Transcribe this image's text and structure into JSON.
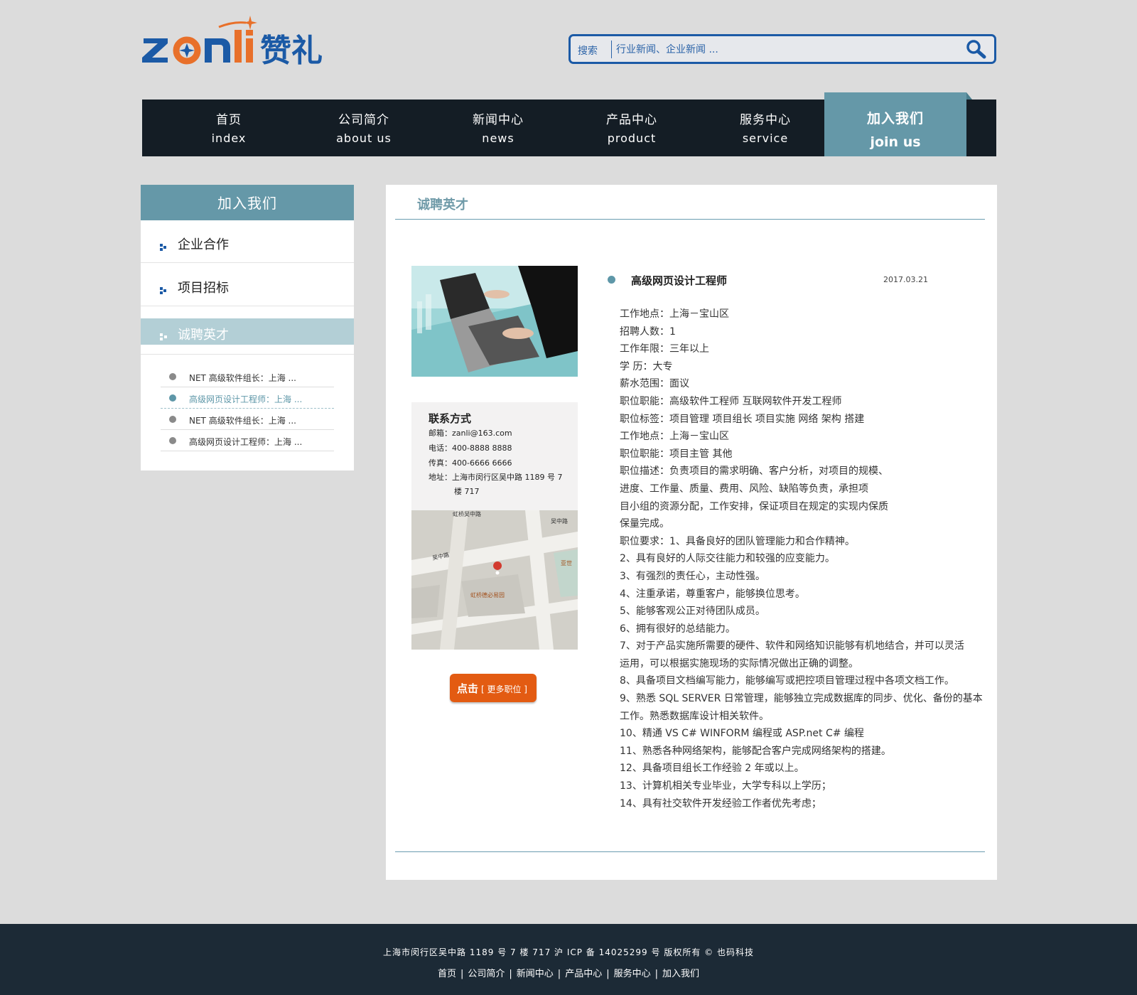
{
  "brand": {
    "logo_text_latin": "zonli",
    "logo_text_cn": "赞礼",
    "colors": {
      "blue": "#1b5aa6",
      "orange": "#e8702a",
      "teal": "#6598a8",
      "nav_bg": "#141d25",
      "footer_bg": "#1c2a36"
    }
  },
  "search": {
    "label": "搜索",
    "placeholder": "行业新闻、企业新闻 ..."
  },
  "nav": {
    "items": [
      {
        "cn": "首页",
        "en": "index"
      },
      {
        "cn": "公司简介",
        "en": "about us"
      },
      {
        "cn": "新闻中心",
        "en": "news"
      },
      {
        "cn": "产品中心",
        "en": "product"
      },
      {
        "cn": "服务中心",
        "en": "service"
      }
    ],
    "active": {
      "cn": "加入我们",
      "en": "join us"
    }
  },
  "sidebar": {
    "title": "加入我们",
    "links": [
      {
        "label": "企业合作"
      },
      {
        "label": "项目招标"
      }
    ],
    "active_link": "诚聘英才",
    "jobs": [
      {
        "title": "NET 高级软件组长：上海 ..."
      },
      {
        "title": "高级网页设计工程师：上海 ..."
      },
      {
        "title": "NET 高级软件组长：上海 ..."
      },
      {
        "title": "高级网页设计工程师：上海 ..."
      }
    ]
  },
  "main": {
    "title": "诚聘英才",
    "contact": {
      "title": "联系方式",
      "email": "邮箱：zanli@163.com",
      "phone": "电话：400-8888 8888",
      "fax": "传真：400-6666 6666",
      "address_line1": "地址：上海市闵行区吴中路 1189 号 7",
      "address_line2": "楼 717"
    },
    "map_labels": {
      "road_top": "虹桥吴中路",
      "road_wuzhong": "吴中路",
      "road_right": "吴中路",
      "place": "虹桥德必易园",
      "right_label": "亚世"
    },
    "more_button": {
      "main": "点击",
      "sub": "[ 更多职位 ]"
    },
    "job": {
      "title": "高级网页设计工程师",
      "date": "2017.03.21",
      "lines": [
        "工作地点：上海－宝山区",
        "招聘人数：1",
        "工作年限：三年以上",
        "学  历：大专",
        "薪水范围：面议",
        "职位职能：高级软件工程师 互联网软件开发工程师",
        "职位标签：项目管理 项目组长 项目实施 网络 架构 搭建",
        "工作地点：上海－宝山区",
        "职位职能：项目主管 其他",
        "职位描述：负责项目的需求明确、客户分析，对项目的规模、",
        "进度、工作量、质量、费用、风险、缺陷等负责，承担项",
        "目小组的资源分配，工作安排，保证项目在规定的实现内保质",
        "保量完成。",
        "职位要求：1、具备良好的团队管理能力和合作精神。",
        "2、具有良好的人际交往能力和较强的应变能力。",
        "3、有强烈的责任心，主动性强。",
        "4、注重承诺，尊重客户，能够换位思考。",
        "5、能够客观公正对待团队成员。",
        "6、拥有很好的总结能力。",
        "7、对于产品实施所需要的硬件、软件和网络知识能够有机地结合，并可以灵活",
        "运用，可以根据实施现场的实际情况做出正确的调整。",
        "8、具备项目文档编写能力，能够编写或把控项目管理过程中各项文档工作。",
        "9、熟悉 SQL SERVER 日常管理，能够独立完成数据库的同步、优化、备份的基本",
        "工作。熟悉数据库设计相关软件。",
        "10、精通 VS C# WINFORM 编程或 ASP.net C# 编程",
        "11、熟悉各种网络架构，能够配合客户完成网络架构的搭建。",
        "12、具备项目组长工作经验 2 年或以上。",
        "13、计算机相关专业毕业，大学专科以上学历；",
        "14、具有社交软件开发经验工作者优先考虑；"
      ]
    }
  },
  "footer": {
    "address": "上海市闵行区吴中路 1189 号 7 楼 717  沪 ICP 备 14025299 号   版权所有 © 也码科技",
    "links": [
      "首页",
      "公司简介",
      "新闻中心",
      "产品中心",
      "服务中心",
      "加入我们"
    ]
  }
}
